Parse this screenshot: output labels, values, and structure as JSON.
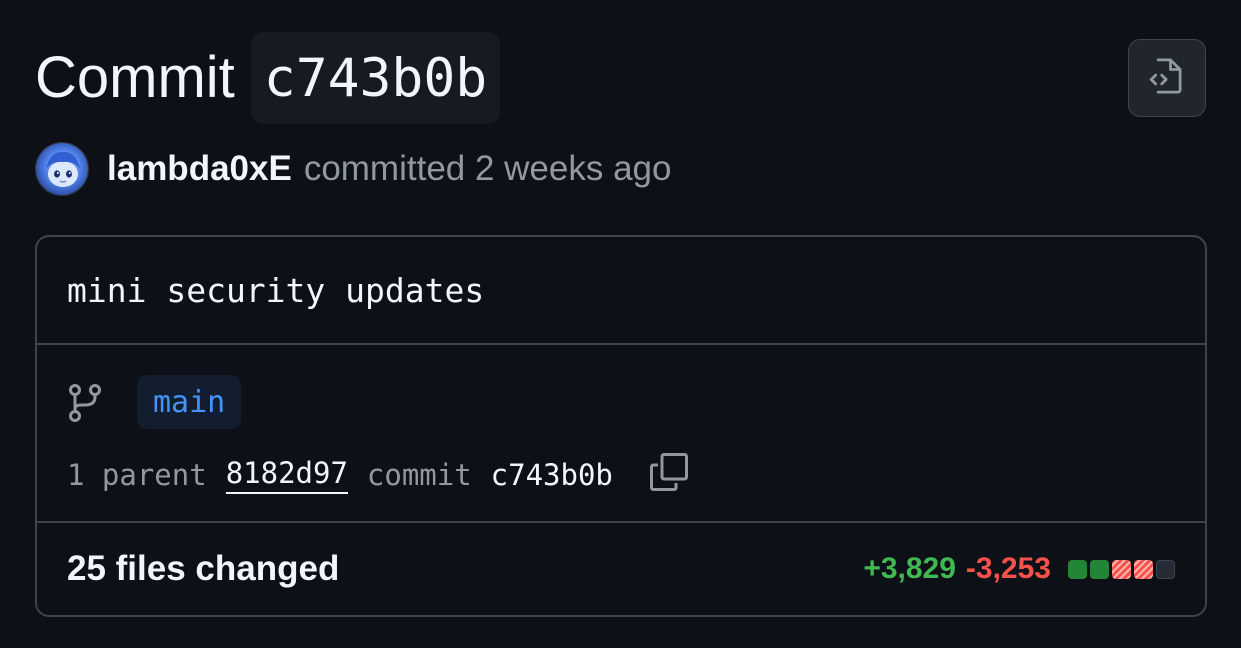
{
  "header": {
    "title_word": "Commit",
    "short_sha": "c743b0b",
    "browse_button_icon": "file-code-icon"
  },
  "author": {
    "avatar_icon": "avatar",
    "name": "lambda0xE",
    "meta": "committed 2 weeks ago"
  },
  "commit": {
    "message": "mini security updates",
    "branch_icon": "git-branch-icon",
    "branch": "main",
    "parent_count_label": "1 parent",
    "parent_sha": "8182d97",
    "commit_label": "commit",
    "commit_sha": "c743b0b",
    "copy_icon": "copy-icon"
  },
  "summary": {
    "files_changed": "25 files changed",
    "additions": "+3,829",
    "deletions": "-3,253",
    "diff_blocks": [
      "added",
      "added",
      "deleted",
      "deleted",
      "neutral"
    ]
  },
  "colors": {
    "background": "#0d1117",
    "additions": "#3fb950",
    "deletions": "#f85149",
    "branch": "#4493f8",
    "border": "#3d444d"
  }
}
